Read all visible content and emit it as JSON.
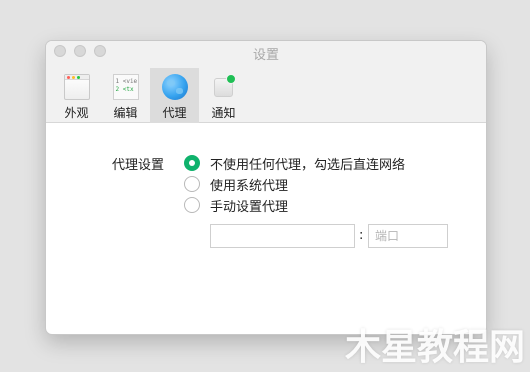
{
  "window": {
    "title": "设置"
  },
  "toolbar": {
    "items": [
      {
        "label": "外观",
        "icon": "appearance-icon"
      },
      {
        "label": "编辑",
        "icon": "editor-icon"
      },
      {
        "label": "代理",
        "icon": "globe-icon",
        "active": true
      },
      {
        "label": "通知",
        "icon": "notification-icon"
      }
    ]
  },
  "editor_icon_lines": [
    "1 <vie",
    "2  <tx"
  ],
  "proxy": {
    "label": "代理设置",
    "options": [
      {
        "label": "不使用任何代理，勾选后直连网络",
        "checked": true
      },
      {
        "label": "使用系统代理",
        "checked": false
      },
      {
        "label": "手动设置代理",
        "checked": false
      }
    ],
    "host": {
      "value": "",
      "placeholder": ""
    },
    "separator": ":",
    "port": {
      "value": "",
      "placeholder": "端口"
    }
  },
  "watermark": "木星教程网",
  "colors": {
    "accent": "#0fb26c",
    "badge": "#1fbf55",
    "globe": "#36a3ef"
  }
}
